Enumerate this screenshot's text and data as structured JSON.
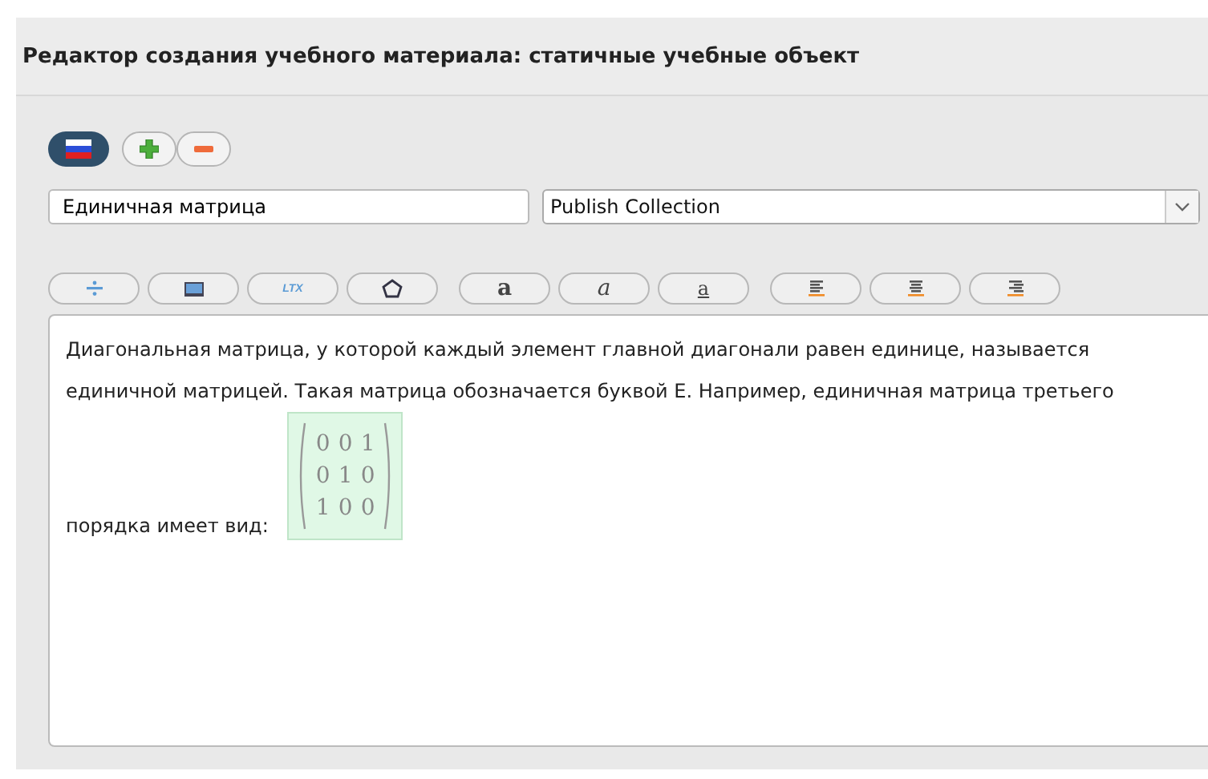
{
  "window": {
    "title": "Редактор создания учебного материала: статичные учебные объект"
  },
  "language_button": {
    "selected": true
  },
  "title_field": {
    "value": "Единичная матрица"
  },
  "collection_select": {
    "value": "Publish Collection"
  },
  "toolbar": [
    {
      "kind": "insert"
    },
    {
      "kind": "image"
    },
    {
      "kind": "text",
      "label": "LTX"
    },
    {
      "kind": "polygon"
    },
    {
      "kind": "bold",
      "label": "a"
    },
    {
      "kind": "italic",
      "label": "a"
    },
    {
      "kind": "underline",
      "label": "a"
    },
    {
      "kind": "align-left"
    },
    {
      "kind": "align-center"
    },
    {
      "kind": "align-right"
    }
  ],
  "editor": {
    "paragraph": "Диагональная матрица, у которой каждый элемент главной диагонали равен единице, называется единичной матрицей. Такая матрица обозначается буквой Е. Например, единичная матрица третьего",
    "caption": "порядка имеет вид:",
    "matrix": [
      [
        "0",
        "0",
        "1"
      ],
      [
        "0",
        "1",
        "0"
      ],
      [
        "1",
        "0",
        "0"
      ]
    ]
  }
}
